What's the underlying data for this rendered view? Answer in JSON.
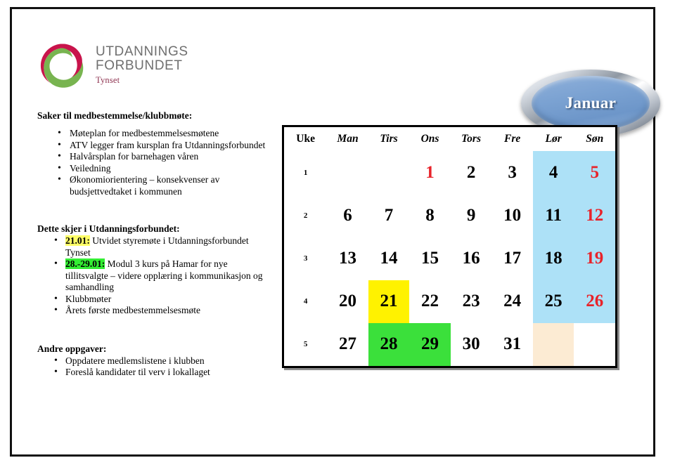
{
  "page": {
    "border_color": "#111111",
    "background": "#ffffff"
  },
  "logo": {
    "name": "utdanningsforbundet-logo",
    "line1": "UTDANNINGS",
    "line2": "FORBUNDET",
    "sub": "Tynset",
    "colors": {
      "red": "#C8144B",
      "green": "#78B450",
      "wordmark": "#6f6f6f",
      "sub": "#8e3350"
    }
  },
  "month_banner": {
    "label": "Januar",
    "fill": "#7ba2d2",
    "rim": "#8f98a3",
    "text_color": "#ffffff"
  },
  "sections": [
    {
      "id": "saker",
      "heading": "Saker til medbestemmelse/klubbmøte:",
      "items": [
        {
          "text": "Møteplan for medbestemmelsesmøtene"
        },
        {
          "text": "ATV legger fram kursplan fra Utdanningsforbundet"
        },
        {
          "text": "Halvårsplan for barnehagen våren"
        },
        {
          "text": "Veiledning"
        },
        {
          "text": "Økonomiorientering – konsekvenser av budsjettvedtaket i kommunen"
        }
      ]
    },
    {
      "id": "dette",
      "heading": "Dette skjer i Utdanningsforbundet:",
      "items": [
        {
          "mark": "21.01:",
          "mark_color": "#FFFF66",
          "text": " Utvidet styremøte i Utdanningsforbundet Tynset"
        },
        {
          "mark": "28.-29.01:",
          "mark_color": "#33EE33",
          "text": " Modul 3 kurs på Hamar for nye tillitsvalgte – videre opplæring i kommunikasjon og samhandling"
        },
        {
          "text": "Klubbmøter"
        },
        {
          "text": "Årets første medbestemmelsesmøte"
        }
      ]
    },
    {
      "id": "andre",
      "heading": "Andre oppgaver:",
      "items": [
        {
          "text": "Oppdatere medlemslistene i klubben"
        },
        {
          "text": "Foreslå kandidater til verv i lokallaget"
        }
      ]
    }
  ],
  "calendar": {
    "title": "Januar",
    "headers": [
      "Uke",
      "Man",
      "Tirs",
      "Ons",
      "Tors",
      "Fre",
      "Lør",
      "Søn"
    ],
    "colors": {
      "weekend_fill": "#ADE1F7",
      "cream_fill": "#FCEBD3",
      "sunday_text": "#E8232A",
      "highlight_yellow": "#FFF200",
      "highlight_green": "#3BE03B",
      "border": "#000000"
    },
    "rows": [
      {
        "week": "1",
        "days": [
          {
            "n": ""
          },
          {
            "n": ""
          },
          {
            "n": "1",
            "style": "holiday"
          },
          {
            "n": "2"
          },
          {
            "n": "3"
          },
          {
            "n": "4",
            "style": "weekend"
          },
          {
            "n": "5",
            "style": "weekend sunday"
          }
        ]
      },
      {
        "week": "2",
        "days": [
          {
            "n": "6"
          },
          {
            "n": "7"
          },
          {
            "n": "8"
          },
          {
            "n": "9"
          },
          {
            "n": "10"
          },
          {
            "n": "11",
            "style": "weekend"
          },
          {
            "n": "12",
            "style": "weekend sunday"
          }
        ]
      },
      {
        "week": "3",
        "days": [
          {
            "n": "13"
          },
          {
            "n": "14"
          },
          {
            "n": "15"
          },
          {
            "n": "16"
          },
          {
            "n": "17"
          },
          {
            "n": "18",
            "style": "weekend"
          },
          {
            "n": "19",
            "style": "weekend sunday"
          }
        ]
      },
      {
        "week": "4",
        "days": [
          {
            "n": "20"
          },
          {
            "n": "21",
            "style": "mark-yellow"
          },
          {
            "n": "22"
          },
          {
            "n": "23"
          },
          {
            "n": "24"
          },
          {
            "n": "25",
            "style": "weekend"
          },
          {
            "n": "26",
            "style": "weekend sunday"
          }
        ]
      },
      {
        "week": "5",
        "days": [
          {
            "n": "27"
          },
          {
            "n": "28",
            "style": "mark-green"
          },
          {
            "n": "29",
            "style": "mark-green"
          },
          {
            "n": "30"
          },
          {
            "n": "31"
          },
          {
            "n": "",
            "style": "cream"
          },
          {
            "n": ""
          }
        ]
      }
    ]
  }
}
